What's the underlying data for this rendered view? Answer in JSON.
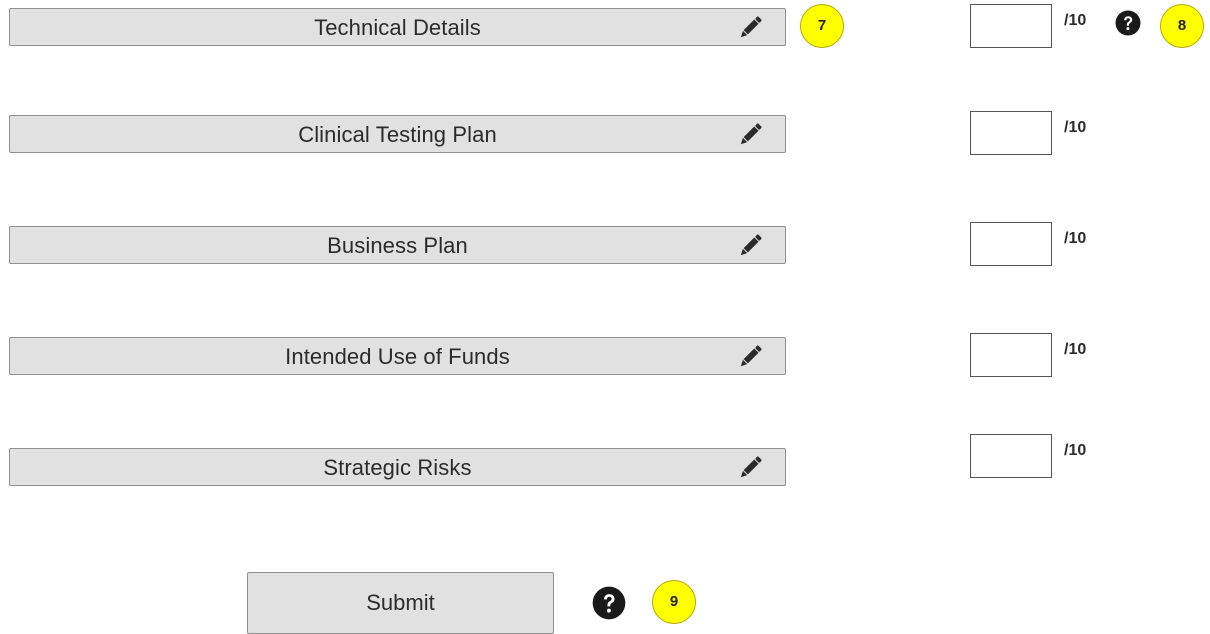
{
  "sections": [
    {
      "label": "Technical Details",
      "score": "",
      "max": "/10"
    },
    {
      "label": "Clinical Testing Plan",
      "score": "",
      "max": "/10"
    },
    {
      "label": "Business Plan",
      "score": "",
      "max": "/10"
    },
    {
      "label": "Intended Use of Funds",
      "score": "",
      "max": "/10"
    },
    {
      "label": "Strategic Risks",
      "score": "",
      "max": "/10"
    }
  ],
  "edit_icon": "pencil-icon",
  "help_icon": "question-circle-icon",
  "markers": {
    "edit_section": "7",
    "score_help": "8",
    "submit_help": "9"
  },
  "marker_color": "#ffff00",
  "button_color": "#e1e1e1",
  "submit": {
    "label": "Submit"
  }
}
